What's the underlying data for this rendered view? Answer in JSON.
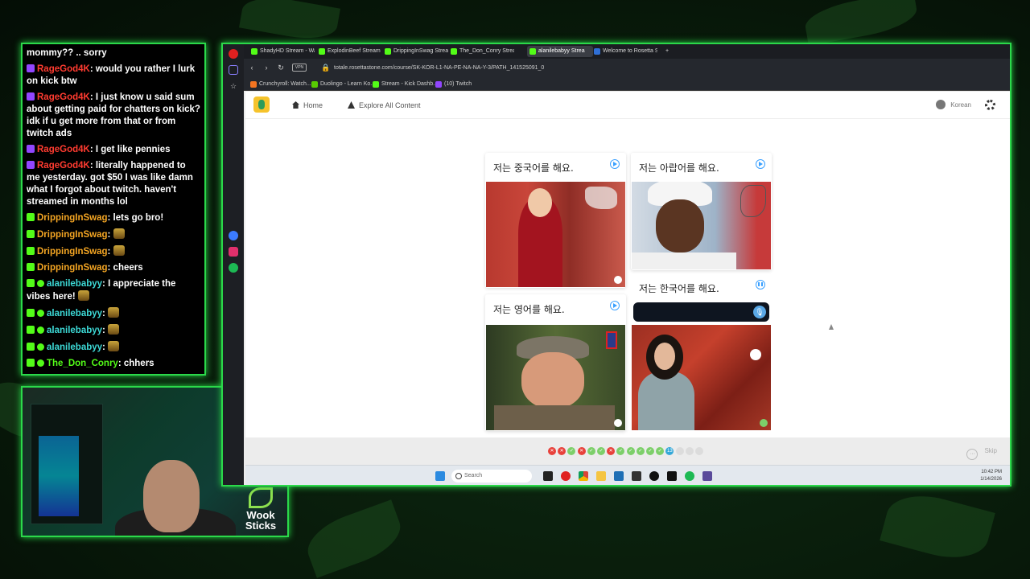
{
  "chat": {
    "messages": [
      {
        "user": "",
        "user_color": "#ffffff",
        "text": "mommy?? .. sorry",
        "platform": "none"
      },
      {
        "user": "RageGod4K",
        "user_color": "#ff3b30",
        "text": ": would you rather I lurk on kick btw",
        "platform": "twitch"
      },
      {
        "user": "RageGod4K",
        "user_color": "#ff3b30",
        "text": ": I just know u said sum about getting paid for chatters on kick? idk if u get more from that or from twitch ads",
        "platform": "twitch"
      },
      {
        "user": "RageGod4K",
        "user_color": "#ff3b30",
        "text": ": I get like pennies",
        "platform": "twitch"
      },
      {
        "user": "RageGod4K",
        "user_color": "#ff3b30",
        "text": ": literally happened to me yesterday. got $50 I was like damn what I forgot about twitch. haven't streamed in months lol",
        "platform": "twitch"
      },
      {
        "user": "DrippingInSwag",
        "user_color": "#f5a623",
        "text": ": lets go bro!",
        "platform": "kick"
      },
      {
        "user": "DrippingInSwag",
        "user_color": "#f5a623",
        "text": ":",
        "platform": "kick",
        "emote": true
      },
      {
        "user": "DrippingInSwag",
        "user_color": "#f5a623",
        "text": ":",
        "platform": "kick",
        "emote": true
      },
      {
        "user": "DrippingInSwag",
        "user_color": "#f5a623",
        "text": ": cheers",
        "platform": "kick"
      },
      {
        "user": "alanilebabyy",
        "user_color": "#3ddad7",
        "text": ": I appreciate the vibes here!",
        "platform": "kick-verified",
        "emote": true
      },
      {
        "user": "alanilebabyy",
        "user_color": "#3ddad7",
        "text": ":",
        "platform": "kick-verified",
        "emote": true
      },
      {
        "user": "alanilebabyy",
        "user_color": "#3ddad7",
        "text": ":",
        "platform": "kick-verified",
        "emote": true
      },
      {
        "user": "alanilebabyy",
        "user_color": "#3ddad7",
        "text": ":",
        "platform": "kick-verified",
        "emote": true
      },
      {
        "user": "The_Don_Conry",
        "user_color": "#53fc18",
        "text": ": chhers",
        "platform": "kick-verified"
      }
    ]
  },
  "webcam": {
    "logo_line1": "Wook",
    "logo_line2": "Sticks"
  },
  "browser": {
    "tabs": [
      {
        "label": "ShadyHD Stream - Wa",
        "active": false
      },
      {
        "label": "ExplodinBeef Stream",
        "active": false
      },
      {
        "label": "DrippingInSwag Strea",
        "active": false
      },
      {
        "label": "The_Don_Conry Strea",
        "active": false
      },
      {
        "label": "alanilebabyy Strea",
        "active": true
      },
      {
        "label": "Welcome to Rosetta S",
        "active": false
      }
    ],
    "url": "totale.rosettastone.com/course/SK-KOR-L1-NA-PE-NA-NA-Y-3/PATH_141525091_0",
    "bookmarks": [
      {
        "label": "Crunchyroll: Watch...",
        "color": "#f47521"
      },
      {
        "label": "Duolingo - Learn Ko...",
        "color": "#58cc02"
      },
      {
        "label": "Stream - Kick Dashb...",
        "color": "#53fc18"
      },
      {
        "label": "(10) Twitch",
        "color": "#9146ff"
      }
    ]
  },
  "rosetta": {
    "nav": {
      "home": "Home",
      "explore": "Explore All Content"
    },
    "account": "Korean",
    "cards": [
      {
        "phrase": "저는 중국어를 해요.",
        "play_state": "play"
      },
      {
        "phrase": "저는 아랍어를 해요.",
        "play_state": "play"
      },
      {
        "phrase": "저는 영어를 해요.",
        "play_state": "play"
      },
      {
        "phrase": "저는 한국어를 해요.",
        "play_state": "pause"
      }
    ],
    "progress": {
      "items": [
        "wrong",
        "wrong",
        "correct",
        "wrong",
        "correct",
        "correct",
        "wrong",
        "correct",
        "correct",
        "correct",
        "correct",
        "correct",
        "current",
        "empty",
        "empty",
        "empty"
      ],
      "current_number": "13",
      "colors": {
        "wrong": "#e8413b",
        "correct": "#7dcf6a",
        "current": "#34a8d8",
        "empty": "#dcdcdc"
      }
    },
    "skip": "Skip"
  },
  "taskbar": {
    "search": "Search",
    "time": "10:42 PM",
    "date": "1/14/2026"
  }
}
